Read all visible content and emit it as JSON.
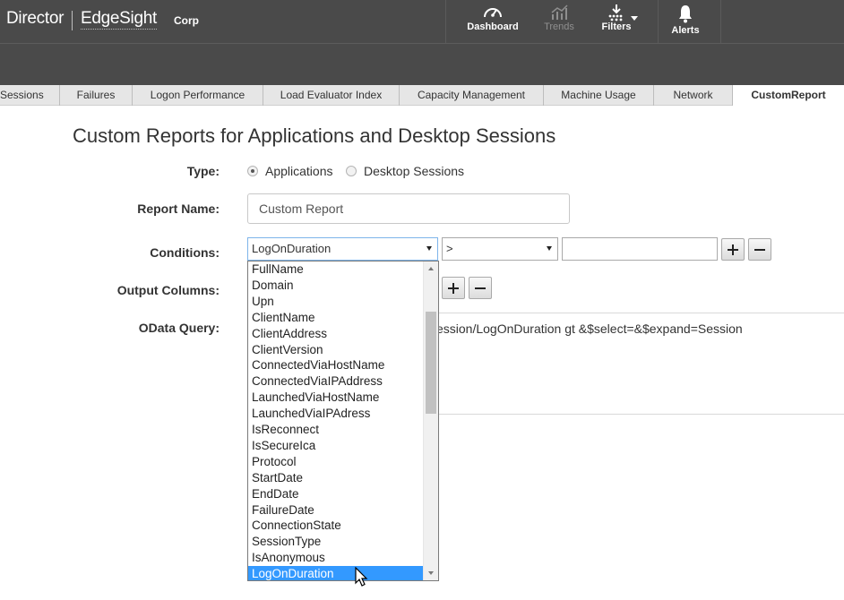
{
  "header": {
    "brand_director": "Director",
    "brand_product": "EdgeSight",
    "tenant": "Corp",
    "nav": [
      {
        "label": "Dashboard",
        "icon": "dashboard-gauge-icon",
        "enabled": true
      },
      {
        "label": "Trends",
        "icon": "trends-chart-icon",
        "enabled": false
      },
      {
        "label": "Filters",
        "icon": "filters-funnel-icon",
        "enabled": true
      },
      {
        "label": "Alerts",
        "icon": "alerts-bell-icon",
        "enabled": true
      }
    ]
  },
  "tabs": [
    {
      "label": "Sessions",
      "active": false
    },
    {
      "label": "Failures",
      "active": false
    },
    {
      "label": "Logon Performance",
      "active": false
    },
    {
      "label": "Load Evaluator Index",
      "active": false
    },
    {
      "label": "Capacity Management",
      "active": false
    },
    {
      "label": "Machine Usage",
      "active": false
    },
    {
      "label": "Network",
      "active": false
    },
    {
      "label": "CustomReport",
      "active": true
    }
  ],
  "form": {
    "title": "Custom Reports for Applications and Desktop Sessions",
    "type_label": "Type:",
    "type_options": [
      {
        "label": "Applications",
        "selected": true
      },
      {
        "label": "Desktop Sessions",
        "selected": false
      }
    ],
    "report_name_label": "Report Name:",
    "report_name_value": "Custom Report",
    "conditions_label": "Conditions:",
    "condition_field": "LogOnDuration",
    "condition_operator": ">",
    "condition_value": "",
    "output_columns_label": "Output Columns:",
    "odata_label": "OData Query:",
    "odata_query_visible": "ession/LogOnDuration gt &$select=&$expand=Session"
  },
  "dropdown": {
    "options": [
      "FullName",
      "Domain",
      "Upn",
      "ClientName",
      "ClientAddress",
      "ClientVersion",
      "ConnectedViaHostName",
      "ConnectedViaIPAddress",
      "LaunchedViaHostName",
      "LaunchedViaIPAdress",
      "IsReconnect",
      "IsSecureIca",
      "Protocol",
      "StartDate",
      "EndDate",
      "FailureDate",
      "ConnectionState",
      "SessionType",
      "IsAnonymous",
      "LogOnDuration"
    ],
    "selected": "LogOnDuration"
  },
  "colors": {
    "topbar": "#4a4a4a",
    "selected_option": "#3399ff",
    "tab_bar": "#e6e6e6"
  }
}
